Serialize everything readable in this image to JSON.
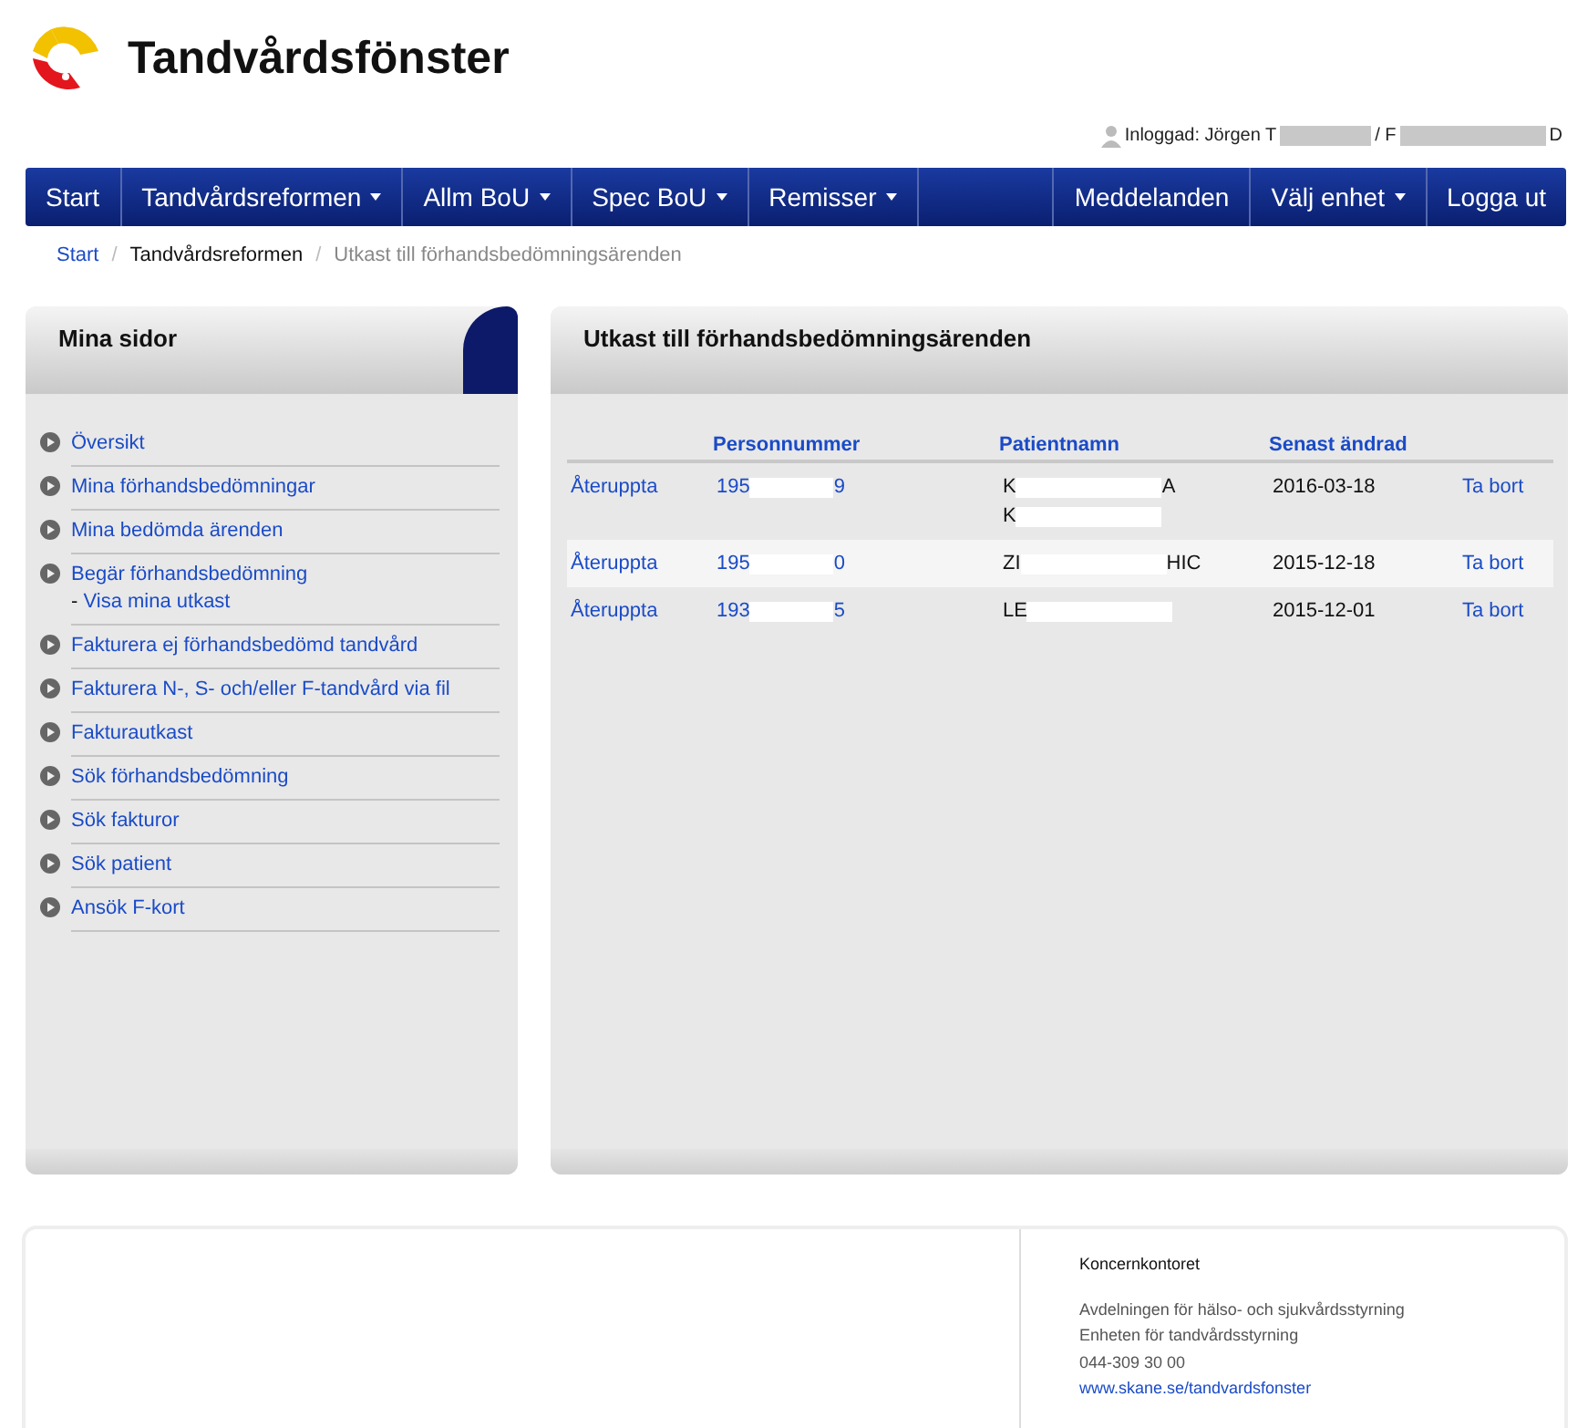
{
  "header": {
    "title": "Tandvårdsfönster",
    "login": [
      "Inloggad: Jörgen T",
      "/ F",
      "D"
    ]
  },
  "nav": {
    "left": [
      {
        "label": "Start",
        "dropdown": false
      },
      {
        "label": "Tandvårdsreformen",
        "dropdown": true
      },
      {
        "label": "Allm BoU",
        "dropdown": true
      },
      {
        "label": "Spec BoU",
        "dropdown": true
      },
      {
        "label": "Remisser",
        "dropdown": true
      }
    ],
    "right": [
      {
        "label": "Meddelanden",
        "dropdown": false
      },
      {
        "label": "Välj enhet",
        "dropdown": true
      },
      {
        "label": "Logga ut",
        "dropdown": false
      }
    ]
  },
  "breadcrumb_separator": "/",
  "breadcrumb": [
    {
      "label": "Start",
      "kind": "link"
    },
    {
      "label": "Tandvårdsreformen",
      "kind": "text"
    },
    {
      "label": "Utkast till förhandsbedömningsärenden",
      "kind": "current"
    }
  ],
  "sidebar": {
    "title": "Mina sidor",
    "items": [
      {
        "label": "Översikt"
      },
      {
        "label": "Mina förhandsbedömningar"
      },
      {
        "label": "Mina bedömda ärenden"
      },
      {
        "label": "Begär förhandsbedömning",
        "sub_prefix": "-",
        "sub": "Visa mina utkast"
      },
      {
        "label": "Fakturera ej förhandsbedömd tandvård"
      },
      {
        "label": "Fakturera N-, S- och/eller F-tandvård via fil"
      },
      {
        "label": "Fakturautkast"
      },
      {
        "label": "Sök förhandsbedömning"
      },
      {
        "label": "Sök fakturor"
      },
      {
        "label": "Sök patient"
      },
      {
        "label": "Ansök F-kort"
      }
    ]
  },
  "main": {
    "title": "Utkast till förhandsbedömningsärenden",
    "columns": [
      "Personnummer",
      "Patientnamn",
      "Senast ändrad"
    ],
    "rows": [
      {
        "action": "Återuppta",
        "personnummer": [
          "195",
          "9"
        ],
        "name": [
          [
            "K",
            "A"
          ],
          [
            "K"
          ]
        ],
        "date": "2016-03-18",
        "remove": "Ta bort",
        "striped": false
      },
      {
        "action": "Återuppta",
        "personnummer": [
          "195",
          "0"
        ],
        "name": [
          [
            "ZI",
            "HIC"
          ]
        ],
        "date": "2015-12-18",
        "remove": "Ta bort",
        "striped": true
      },
      {
        "action": "Återuppta",
        "personnummer": [
          "193",
          "5"
        ],
        "name": [
          [
            "LE"
          ]
        ],
        "date": "2015-12-01",
        "remove": "Ta bort",
        "striped": false
      }
    ]
  },
  "footer": {
    "org": "Koncernkontoret",
    "lines": [
      "Avdelningen för hälso- och sjukvårdsstyrning",
      "Enheten för tandvårdsstyrning",
      "044-309 30 00"
    ],
    "link": "www.skane.se/tandvardsfonster"
  }
}
